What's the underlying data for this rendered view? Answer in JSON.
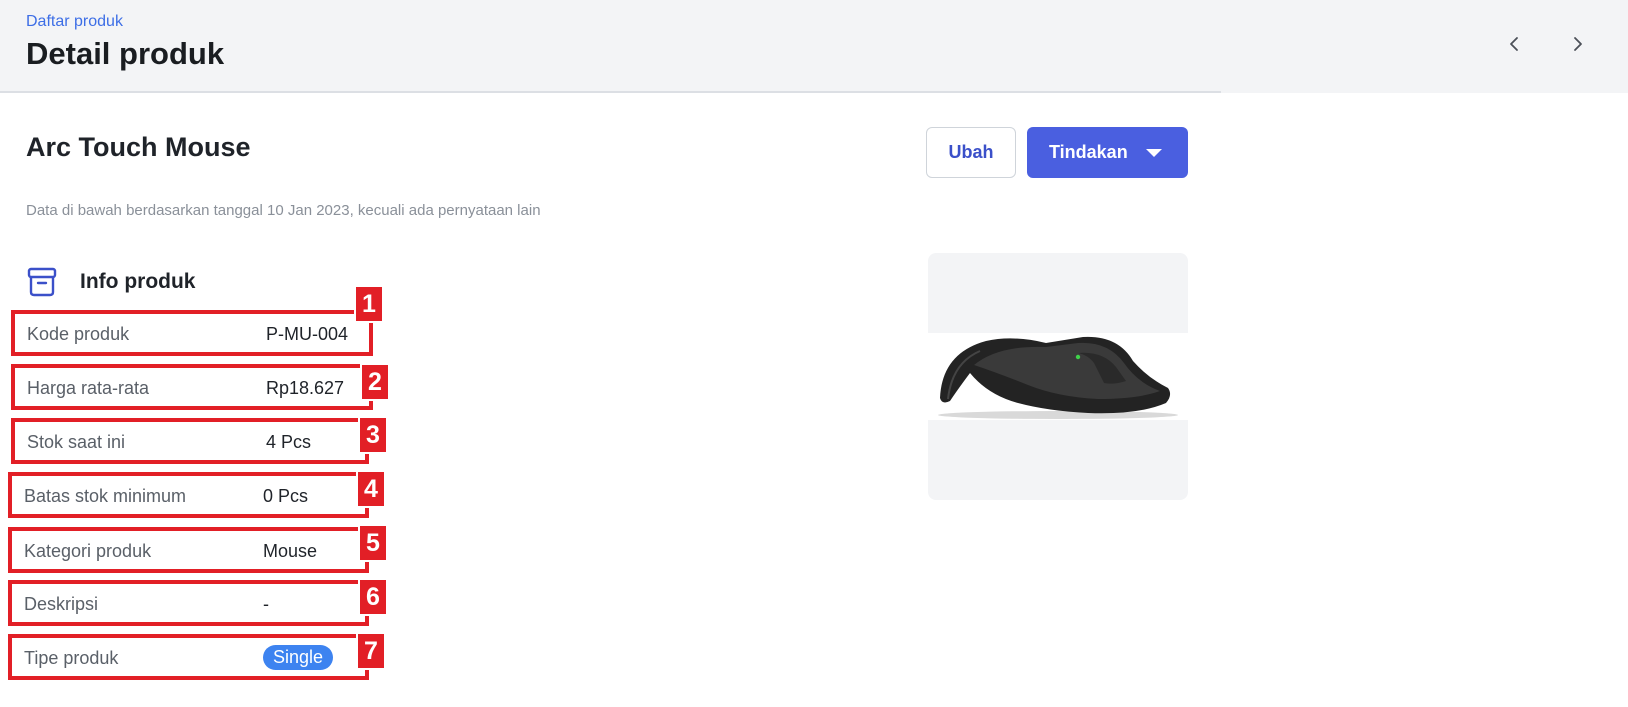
{
  "header": {
    "breadcrumb": "Daftar produk",
    "title": "Detail produk"
  },
  "nav": {
    "prev_icon": "chevron-left-icon",
    "next_icon": "chevron-right-icon"
  },
  "product": {
    "name": "Arc Touch Mouse",
    "edit_label": "Ubah",
    "actions_label": "Tindakan",
    "note": "Data di bawah berdasarkan tanggal 10 Jan 2023, kecuali ada pernyataan lain"
  },
  "section": {
    "icon": "archive-box-icon",
    "title": "Info produk"
  },
  "rows": [
    {
      "num": "1",
      "label": "Kode produk",
      "value": "P-MU-004"
    },
    {
      "num": "2",
      "label": "Harga rata-rata",
      "value": "Rp18.627"
    },
    {
      "num": "3",
      "label": "Stok saat ini",
      "value": "4 Pcs"
    },
    {
      "num": "4",
      "label": "Batas stok minimum",
      "value": "0 Pcs"
    },
    {
      "num": "5",
      "label": "Kategori produk",
      "value": "Mouse"
    },
    {
      "num": "6",
      "label": "Deskripsi",
      "value": "-"
    },
    {
      "num": "7",
      "label": "Tipe produk",
      "value": "Single"
    }
  ],
  "colors": {
    "accent": "#4a5fe0",
    "badge": "#3d83f0",
    "highlight": "#e21f26",
    "link": "#3d6ee6"
  }
}
